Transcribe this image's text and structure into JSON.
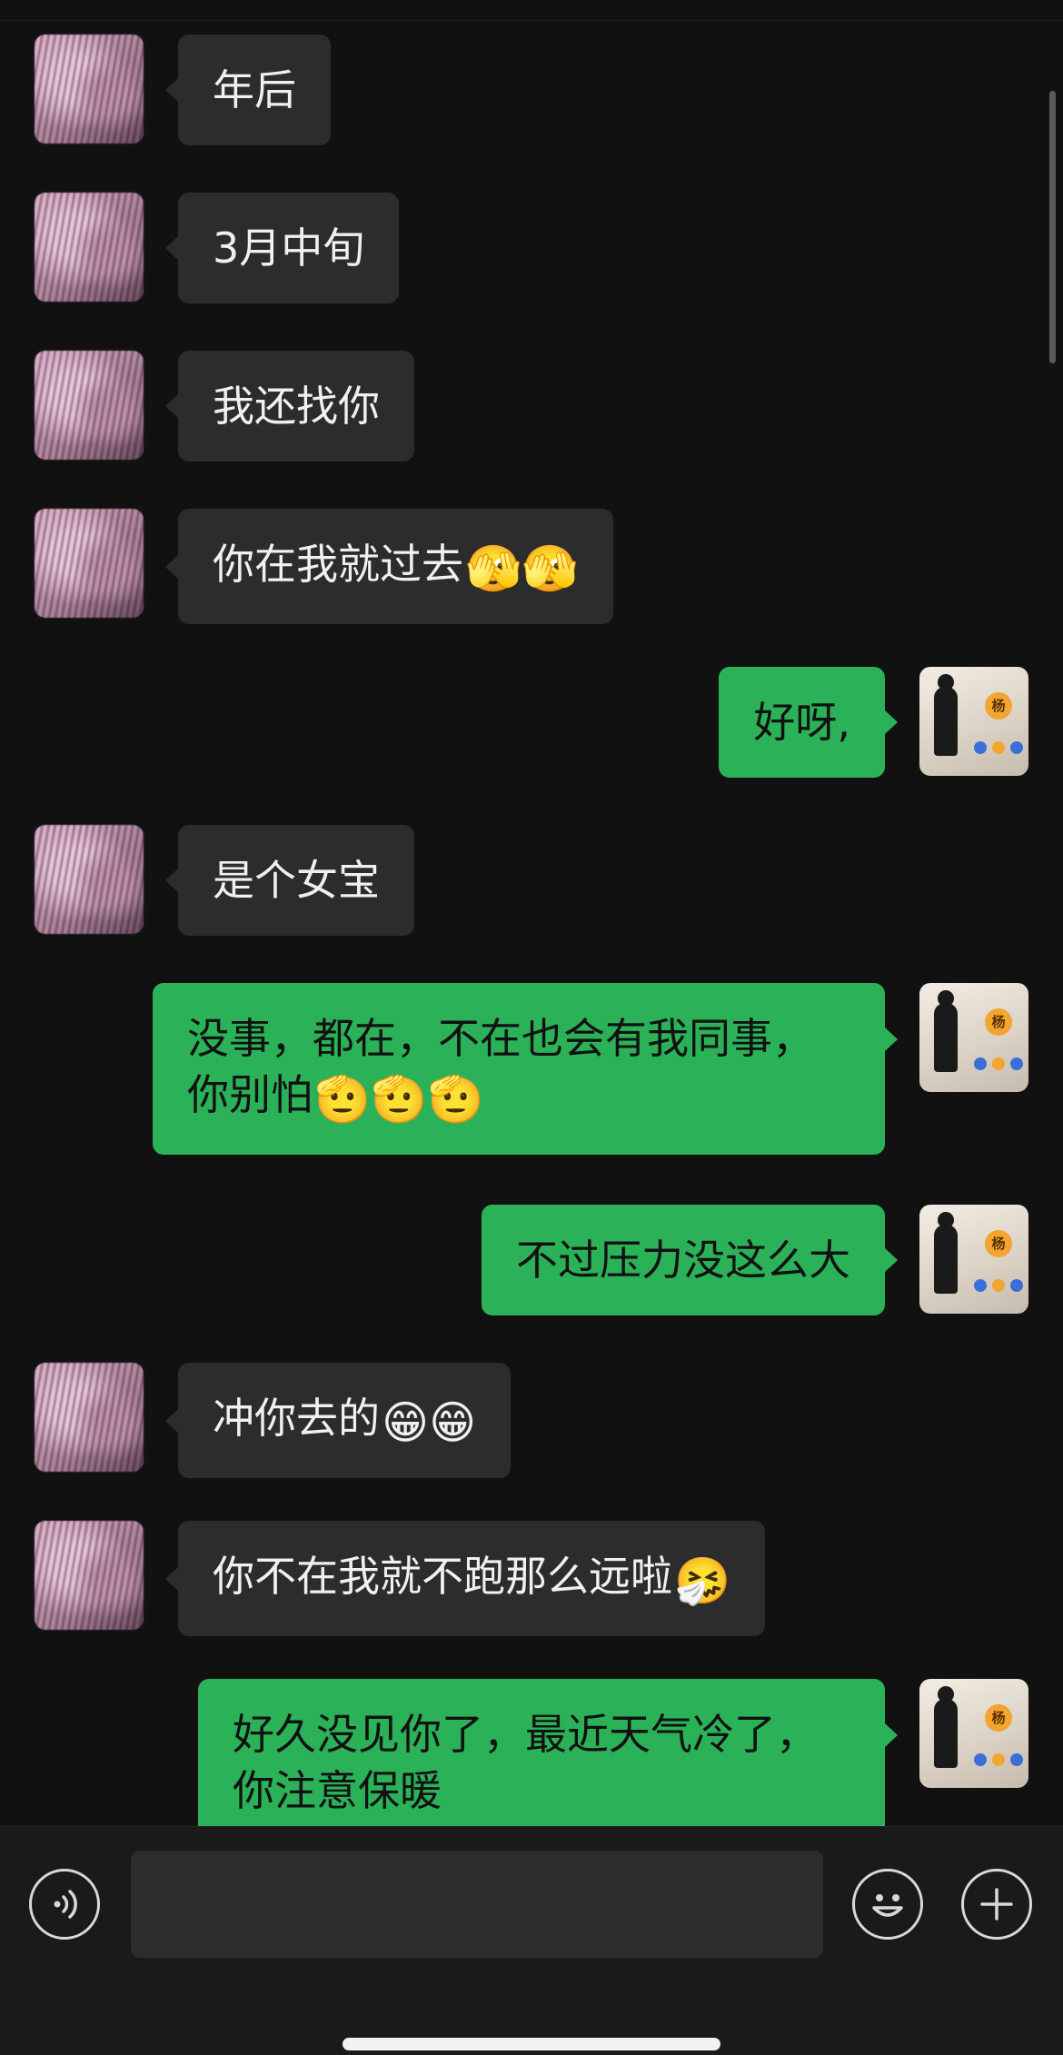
{
  "messages": [
    {
      "side": "in",
      "text": "年后"
    },
    {
      "side": "in",
      "text": "3月中旬"
    },
    {
      "side": "in",
      "text": "我还找你"
    },
    {
      "side": "in",
      "text": "你在我就过去",
      "emoji": "🫣🫣"
    },
    {
      "side": "out",
      "text": "好呀,"
    },
    {
      "side": "in",
      "text": "是个女宝"
    },
    {
      "side": "out",
      "line1": "没事，都在，不在也会有我同事，",
      "line2": "你别怕",
      "emoji": "🫡🫡🫡"
    },
    {
      "side": "out",
      "text": "不过压力没这么大"
    },
    {
      "side": "in",
      "text": "冲你去的",
      "emoji": "😁😁"
    },
    {
      "side": "in",
      "text": "你不在我就不跑那么远啦",
      "emoji": "🤧"
    },
    {
      "side": "out",
      "line1": "好久没见你了，最近天气冷了，",
      "line2": "你注意保暖"
    }
  ],
  "my_avatar": {
    "badge": "杨"
  },
  "input": {
    "value": ""
  },
  "icons": {
    "voice": "voice-icon",
    "emoji": "emoji-icon",
    "more": "plus-icon"
  },
  "colors": {
    "background": "#111111",
    "incoming_bubble": "#2c2c2c",
    "outgoing_bubble": "#2bb259"
  }
}
